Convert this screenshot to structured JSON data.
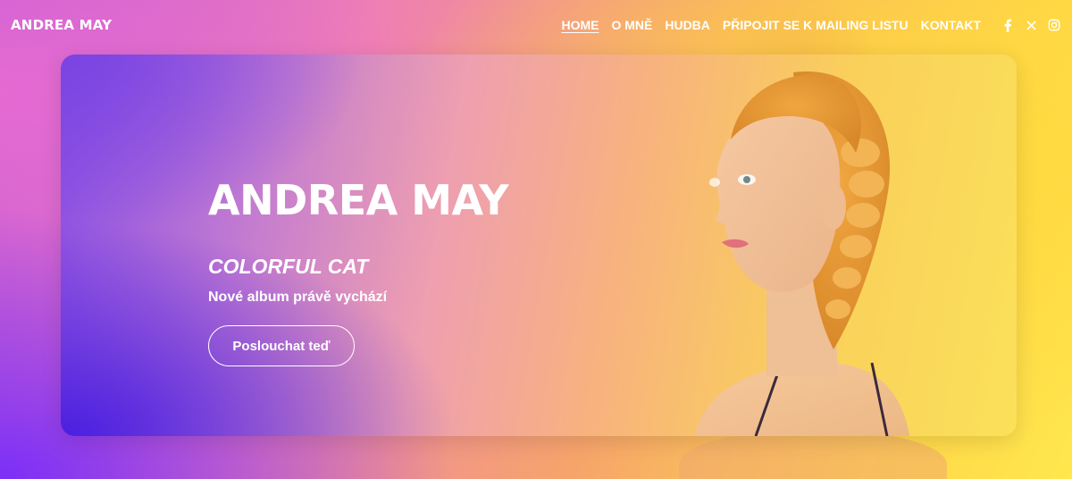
{
  "header": {
    "logo": "ANDREA MAY",
    "nav": [
      {
        "label": "HOME",
        "active": true
      },
      {
        "label": "O MNĚ"
      },
      {
        "label": "HUDBA"
      },
      {
        "label": "PŘIPOJIT SE K MAILING LISTU"
      },
      {
        "label": "KONTAKT"
      }
    ],
    "social": [
      "facebook-icon",
      "x-icon",
      "instagram-icon"
    ]
  },
  "hero": {
    "title": "ANDREA MAY",
    "album": "COLORFUL CAT",
    "subtitle": "Nové album právě vychází",
    "button": "Poslouchat teď"
  },
  "colors": {
    "accent_purple": "#4a1fe0",
    "accent_yellow": "#ffe74d",
    "accent_pink": "#ee7fb4",
    "text": "#ffffff"
  }
}
